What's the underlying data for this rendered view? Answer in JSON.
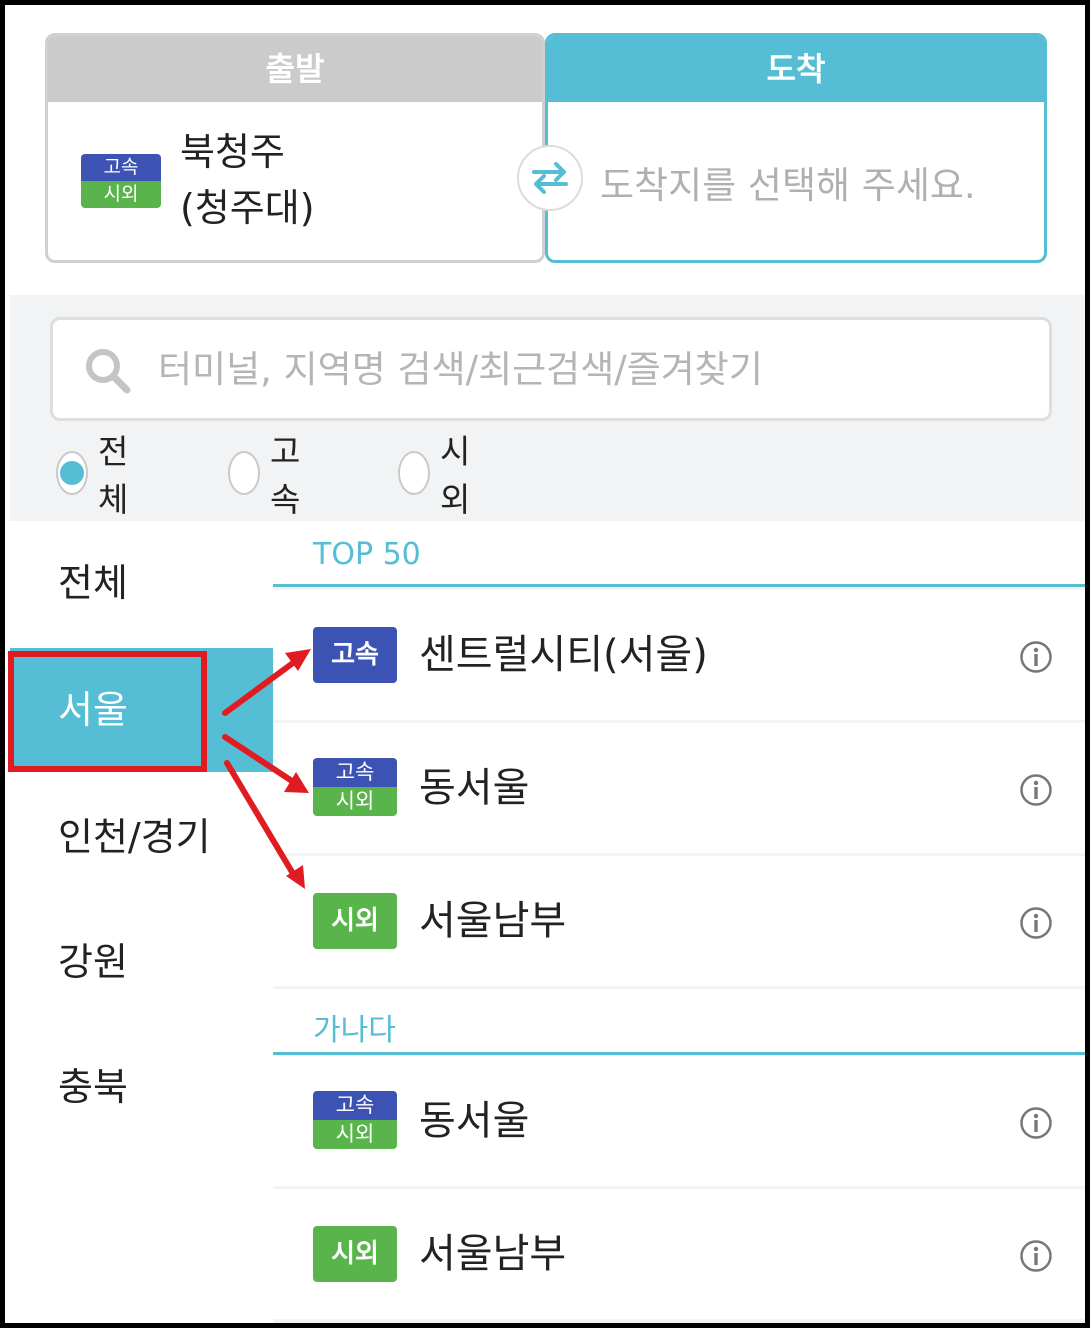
{
  "route": {
    "departure": {
      "header": "출발",
      "badge_top": "고속",
      "badge_bottom": "시외",
      "name_line1": "북청주",
      "name_line2": "(청주대)"
    },
    "arrival": {
      "header": "도착",
      "placeholder": "도착지를 선택해 주세요."
    },
    "swap_icon": "swap-arrows-icon"
  },
  "search": {
    "placeholder": "터미널, 지역명 검색/최근검색/즐겨찾기",
    "icon": "search-icon"
  },
  "filters": [
    {
      "label": "전체",
      "selected": true
    },
    {
      "label": "고속",
      "selected": false
    },
    {
      "label": "시외",
      "selected": false
    }
  ],
  "regions": [
    "전체",
    "서울",
    "인천/경기",
    "강원",
    "충북"
  ],
  "active_region": "서울",
  "sections": {
    "top": "TOP 50",
    "alpha": "가나다"
  },
  "terminals": {
    "top": [
      {
        "name": "센트럴시티(서울)",
        "type": "고속"
      },
      {
        "name": "동서울",
        "type_top": "고속",
        "type_bottom": "시외"
      },
      {
        "name": "서울남부",
        "type": "시외"
      }
    ],
    "alpha": [
      {
        "name": "동서울",
        "type_top": "고속",
        "type_bottom": "시외"
      },
      {
        "name": "서울남부",
        "type": "시외"
      }
    ]
  },
  "colors": {
    "accent": "#55bdd4",
    "express": "#3d53b4",
    "intercity": "#59b54b",
    "annotation": "#e11b22"
  }
}
